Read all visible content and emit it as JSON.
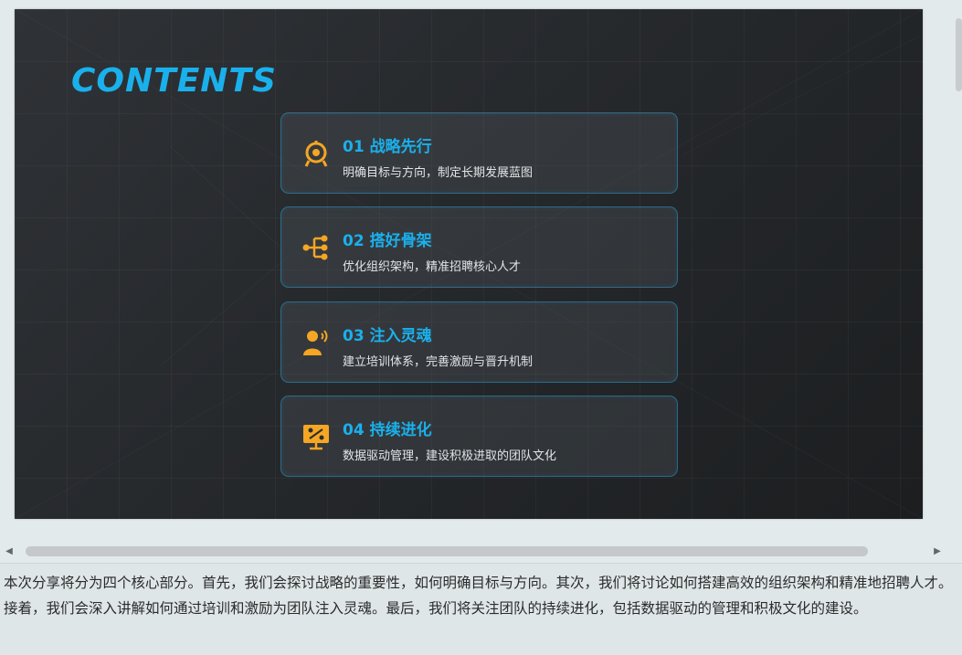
{
  "slide": {
    "title": "CONTENTS",
    "accent_color": "#1ab0ec",
    "icon_color": "#f5a623",
    "items": [
      {
        "heading": "01 战略先行",
        "desc": "明确目标与方向，制定长期发展蓝图",
        "icon": "target-icon"
      },
      {
        "heading": "02 搭好骨架",
        "desc": "优化组织架构，精准招聘核心人才",
        "icon": "org-chart-icon"
      },
      {
        "heading": "03 注入灵魂",
        "desc": "建立培训体系，完善激励与晋升机制",
        "icon": "speaker-person-icon"
      },
      {
        "heading": "04 持续进化",
        "desc": "数据驱动管理，建设积极进取的团队文化",
        "icon": "presentation-board-icon"
      }
    ]
  },
  "scrollbar": {
    "left_arrow": "◀",
    "right_arrow": "▶"
  },
  "notes": {
    "text": "本次分享将分为四个核心部分。首先，我们会探讨战略的重要性，如何明确目标与方向。其次，我们将讨论如何搭建高效的组织架构和精准地招聘人才。接着，我们会深入讲解如何通过培训和激励为团队注入灵魂。最后，我们将关注团队的持续进化，包括数据驱动的管理和积极文化的建设。"
  }
}
